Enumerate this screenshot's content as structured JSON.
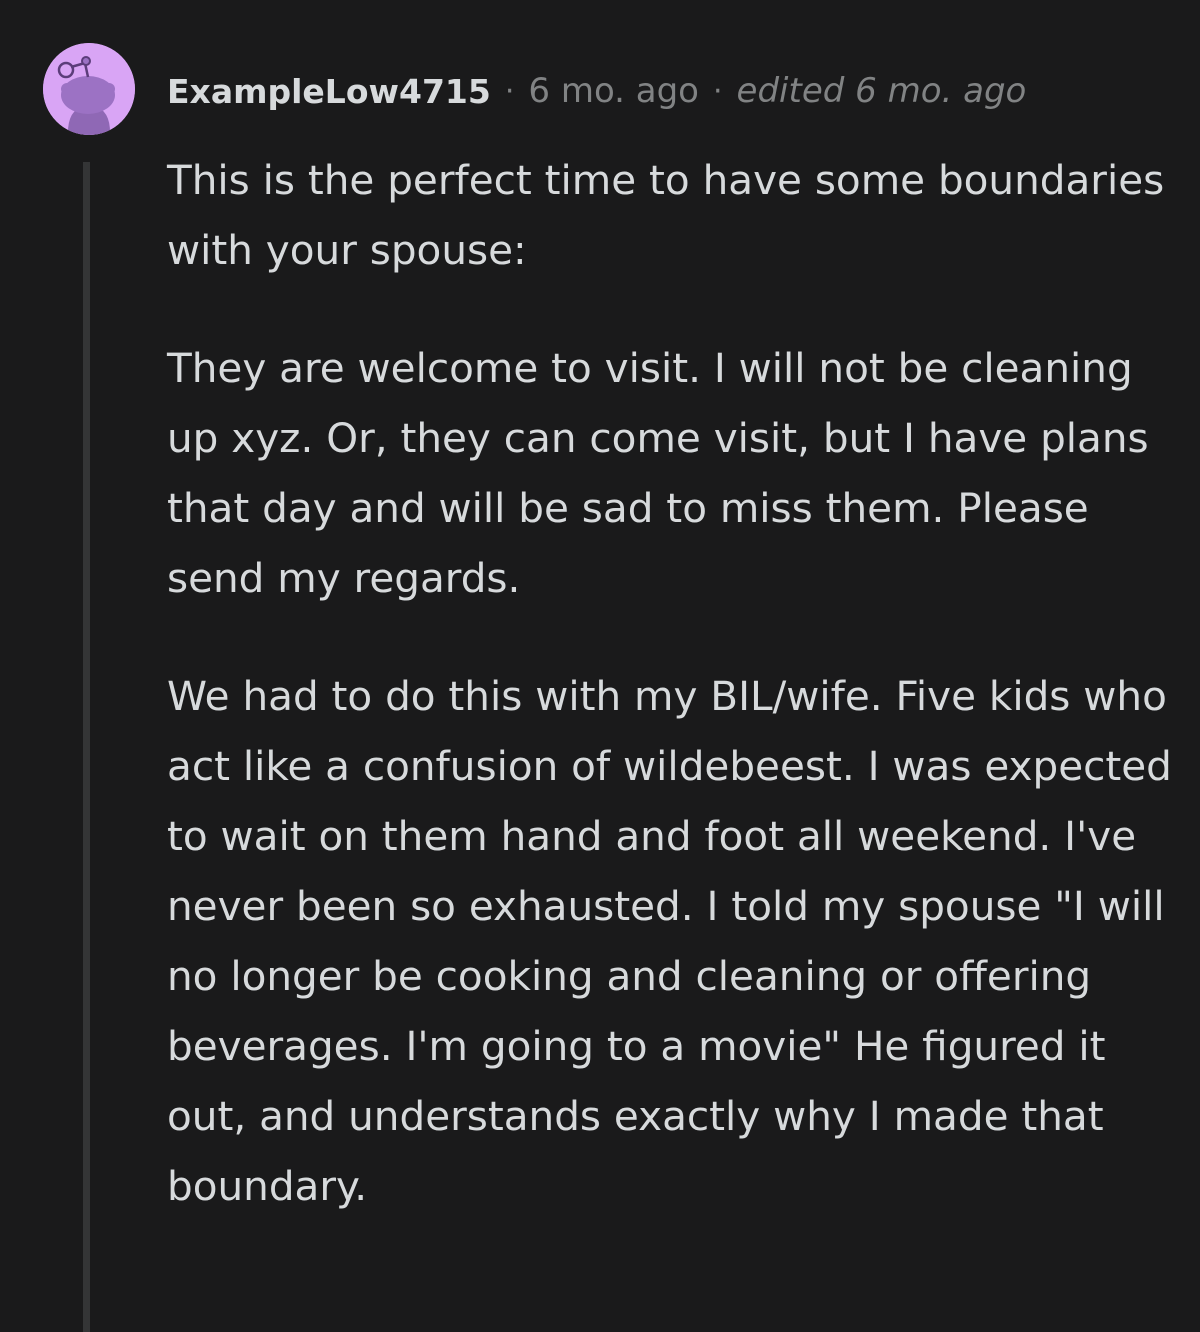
{
  "comment": {
    "avatar_icon": "snoo-avatar-icon",
    "avatar_color": "#d9a5f5",
    "username": "ExampleLow4715",
    "separator": "·",
    "timestamp": "6 mo. ago",
    "edited": "edited 6 mo. ago",
    "paragraphs": [
      "This is the perfect time to have some boundaries with your spouse:",
      "They are welcome to visit. I will not be cleaning up xyz. Or, they can come visit, but I have plans that day and will be sad to miss them. Please send my regards.",
      "We had to do this with my BIL/wife. Five kids who act like a confusion of wildebeest. I was expected to wait on them hand and foot all weekend. I've never been so exhausted. I told my spouse \"I will no longer be cooking and cleaning or offering beverages. I'm going to a movie\" He figured it out, and understands exactly why I made that boundary."
    ]
  }
}
